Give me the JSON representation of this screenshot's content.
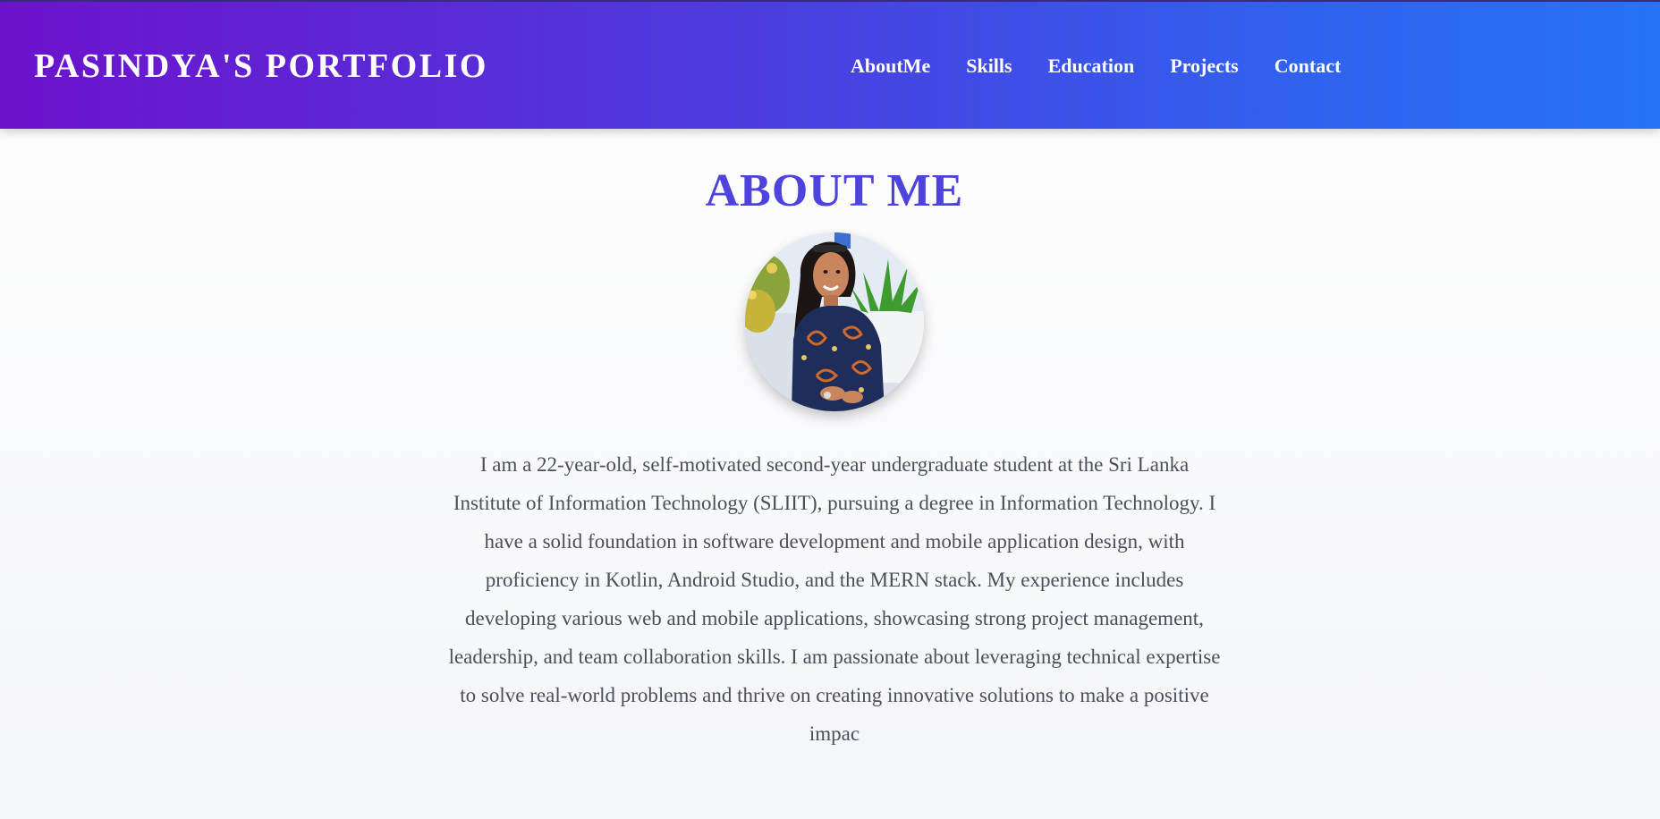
{
  "header": {
    "brand": "PASINDYA'S PORTFOLIO",
    "nav": [
      "AboutMe",
      "Skills",
      "Education",
      "Projects",
      "Contact"
    ]
  },
  "about": {
    "title": "ABOUT ME",
    "avatar_icon": "profile-photo",
    "bio": "I am a 22-year-old, self-motivated second-year undergraduate student at the Sri Lanka Institute of Information Technology (SLIIT), pursuing a degree in Information Technology. I have a solid foundation in software development and mobile application design, with proficiency in Kotlin, Android Studio, and the MERN stack. My experience includes developing various web and mobile applications, showcasing strong project management, leadership, and team collaboration skills. I am passionate about leveraging technical expertise to solve real-world problems and thrive on creating innovative solutions to make a positive impac"
  },
  "colors": {
    "header_gradient_start": "#6d12cc",
    "header_gradient_end": "#2673f7",
    "title_color": "#4e43dc",
    "body_text": "#4a4f59"
  }
}
